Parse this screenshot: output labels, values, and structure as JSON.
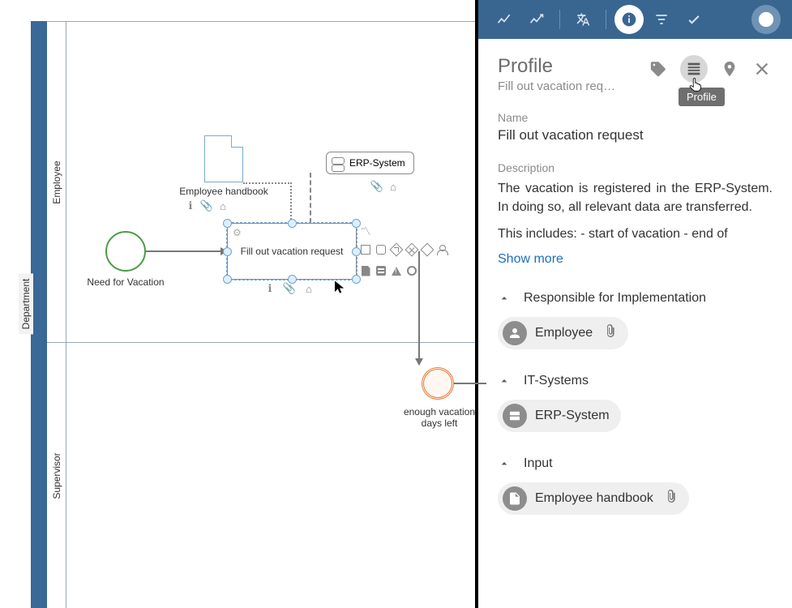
{
  "canvas": {
    "pool_label": "Department",
    "lanes": {
      "employee": "Employee",
      "supervisor": "Supervisor"
    },
    "nodes": {
      "start_event": "Need for Vacation",
      "task_selected": "Fill out vacation request",
      "handbook": "Employee handbook",
      "erp": "ERP-System",
      "intermediate_event": "enough vacation days left"
    }
  },
  "topbar": {
    "icons": [
      "trend-icon",
      "trend-up-icon",
      "translate-icon",
      "info-icon",
      "filter-icon",
      "check-icon",
      "help-icon"
    ]
  },
  "panel": {
    "header": {
      "title": "Profile",
      "subtitle": "Fill out vacation req…",
      "tooltip": "Profile",
      "action_icons": [
        "tag-icon",
        "profile-icon",
        "place-icon",
        "close-icon"
      ]
    },
    "name_label": "Name",
    "name_value": "Fill out vacation request",
    "description_label": "Description",
    "description_p1": "The vacation is registered in the ERP-System. In doing so, all relevant data are transferred.",
    "description_p2": "This includes: - start of vacation - end of",
    "show_more": "Show more",
    "sections": {
      "responsible": {
        "title": "Responsible for Implementation",
        "chip": "Employee",
        "has_attachment": true
      },
      "it": {
        "title": "IT-Systems",
        "chip": "ERP-System",
        "has_attachment": false
      },
      "input": {
        "title": "Input",
        "chip": "Employee handbook",
        "has_attachment": true
      }
    }
  }
}
